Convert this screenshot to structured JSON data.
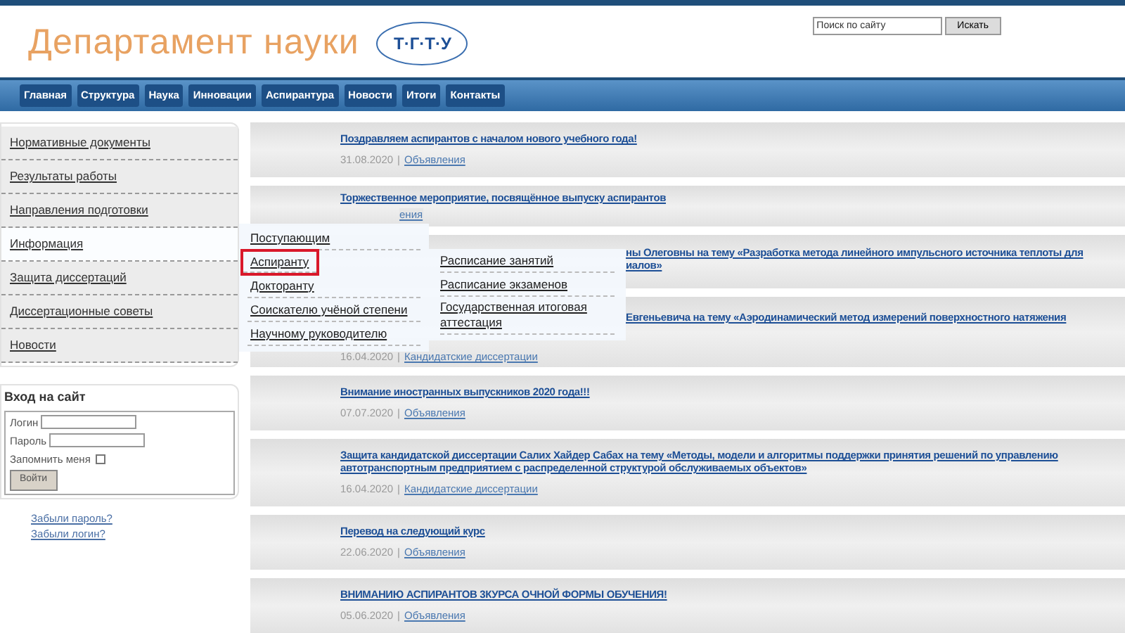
{
  "header": {
    "title": "Департамент науки",
    "logo_text": "Т·Г·Т·У",
    "search": {
      "placeholder": "Поиск по сайту",
      "button": "Искать"
    }
  },
  "nav": [
    "Главная",
    "Структура",
    "Наука",
    "Инновации",
    "Аспирантура",
    "Новости",
    "Итоги",
    "Контакты"
  ],
  "sidebar": {
    "items": [
      {
        "label": "Нормативные документы",
        "selected": false
      },
      {
        "label": "Результаты работы",
        "selected": false
      },
      {
        "label": "Направления подготовки",
        "selected": false
      },
      {
        "label": "Информация",
        "selected": true
      },
      {
        "label": "Защита диссертаций",
        "selected": false
      },
      {
        "label": "Диссертационные советы",
        "selected": false
      },
      {
        "label": "Новости",
        "selected": false
      }
    ]
  },
  "login": {
    "title": "Вход на сайт",
    "login_label": "Логин",
    "password_label": "Пароль",
    "remember_label": "Запомнить меня",
    "remember": false,
    "button": "Войти",
    "links": [
      "Забыли пароль?",
      "Забыли логин?"
    ]
  },
  "news": [
    {
      "kind": "full",
      "title": "Поздравляем аспирантов с началом нового учебного года!",
      "date": "31.08.2020",
      "separator": "|",
      "category": "Объявления"
    },
    {
      "kind": "partial",
      "title": "Торжественное мероприятие, посвящённое выпуску аспирантов",
      "category": "ения"
    },
    {
      "kind": "covered",
      "title_lines": [
        "ны Олеговны на тему «Разработка метода линейного импульсного источника теплоты для",
        "иалов»"
      ]
    },
    {
      "kind": "covered_dated",
      "title_lines": [
        "Евгеньевича на тему «Аэродинамический метод измерений поверхностного натяжения"
      ],
      "date": "16.04.2020",
      "separator": "|",
      "category": "Кандидатские диссертации"
    },
    {
      "kind": "full",
      "title": "Внимание иностранных выпускников 2020 года!!!",
      "date": "07.07.2020",
      "separator": "|",
      "category": "Объявления"
    },
    {
      "kind": "full",
      "title": "Защита кандидатской диссертации Салих Хайдер Сабах на тему «Методы, модели и алгоритмы поддержки принятия решений по управлению автотранспортным предприятием с распределенной структурой обслуживаемых объектов»",
      "date": "16.04.2020",
      "separator": "|",
      "category": "Кандидатские диссертации"
    },
    {
      "kind": "full",
      "title": "Перевод на следующий курс",
      "date": "22.06.2020",
      "separator": "|",
      "category": "Объявления"
    },
    {
      "kind": "full",
      "title": "ВНИМАНИЮ АСПИРАНТОВ 3КУРСА ОЧНОЙ ФОРМЫ ОБУЧЕНИЯ!",
      "date": "05.06.2020",
      "separator": "|",
      "category": "Объявления"
    }
  ],
  "dropdown": {
    "items": [
      {
        "label": "Поступающим",
        "selected": false
      },
      {
        "label": "Аспиранту",
        "selected": true
      },
      {
        "label": "Докторанту",
        "selected": false
      },
      {
        "label": "Соискателю учёной степени",
        "selected": false
      },
      {
        "label": "Научному руководителю",
        "selected": false
      }
    ],
    "submenu": [
      "Расписание занятий",
      "Расписание экзаменов",
      "Государственная итоговая аттестация"
    ]
  }
}
